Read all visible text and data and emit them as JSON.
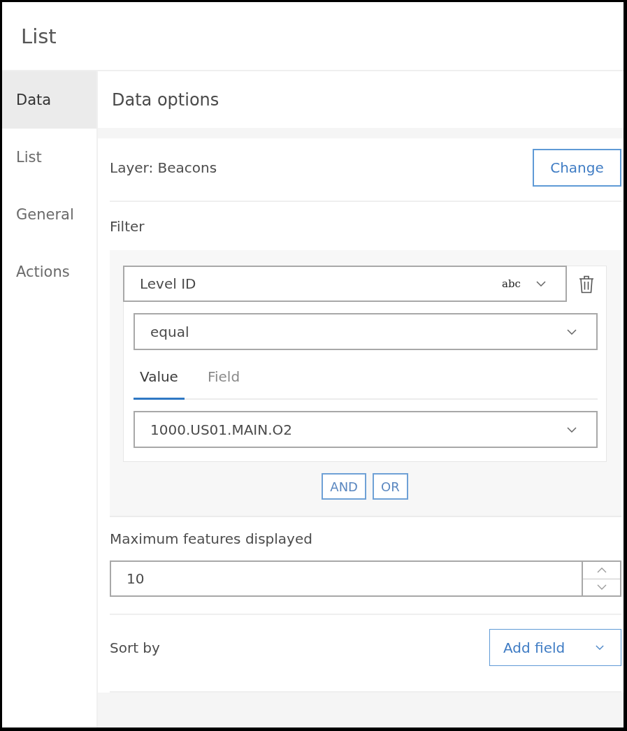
{
  "panel": {
    "title": "List"
  },
  "sidebar": {
    "items": [
      {
        "label": "Data",
        "selected": true
      },
      {
        "label": "List",
        "selected": false
      },
      {
        "label": "General",
        "selected": false
      },
      {
        "label": "Actions",
        "selected": false
      }
    ]
  },
  "section": {
    "title": "Data options"
  },
  "layer": {
    "label": "Layer: Beacons",
    "button": "Change"
  },
  "filter": {
    "label": "Filter",
    "field": {
      "value": "Level ID",
      "type_badge": "abc"
    },
    "operator": {
      "value": "equal"
    },
    "tabs": [
      {
        "label": "Value",
        "selected": true
      },
      {
        "label": "Field",
        "selected": false
      }
    ],
    "value": {
      "value": "1000.US01.MAIN.O2"
    },
    "buttons": [
      "AND",
      "OR"
    ]
  },
  "max_features": {
    "label": "Maximum features displayed",
    "value": "10"
  },
  "sort": {
    "label": "Sort by",
    "button": "Add field"
  }
}
